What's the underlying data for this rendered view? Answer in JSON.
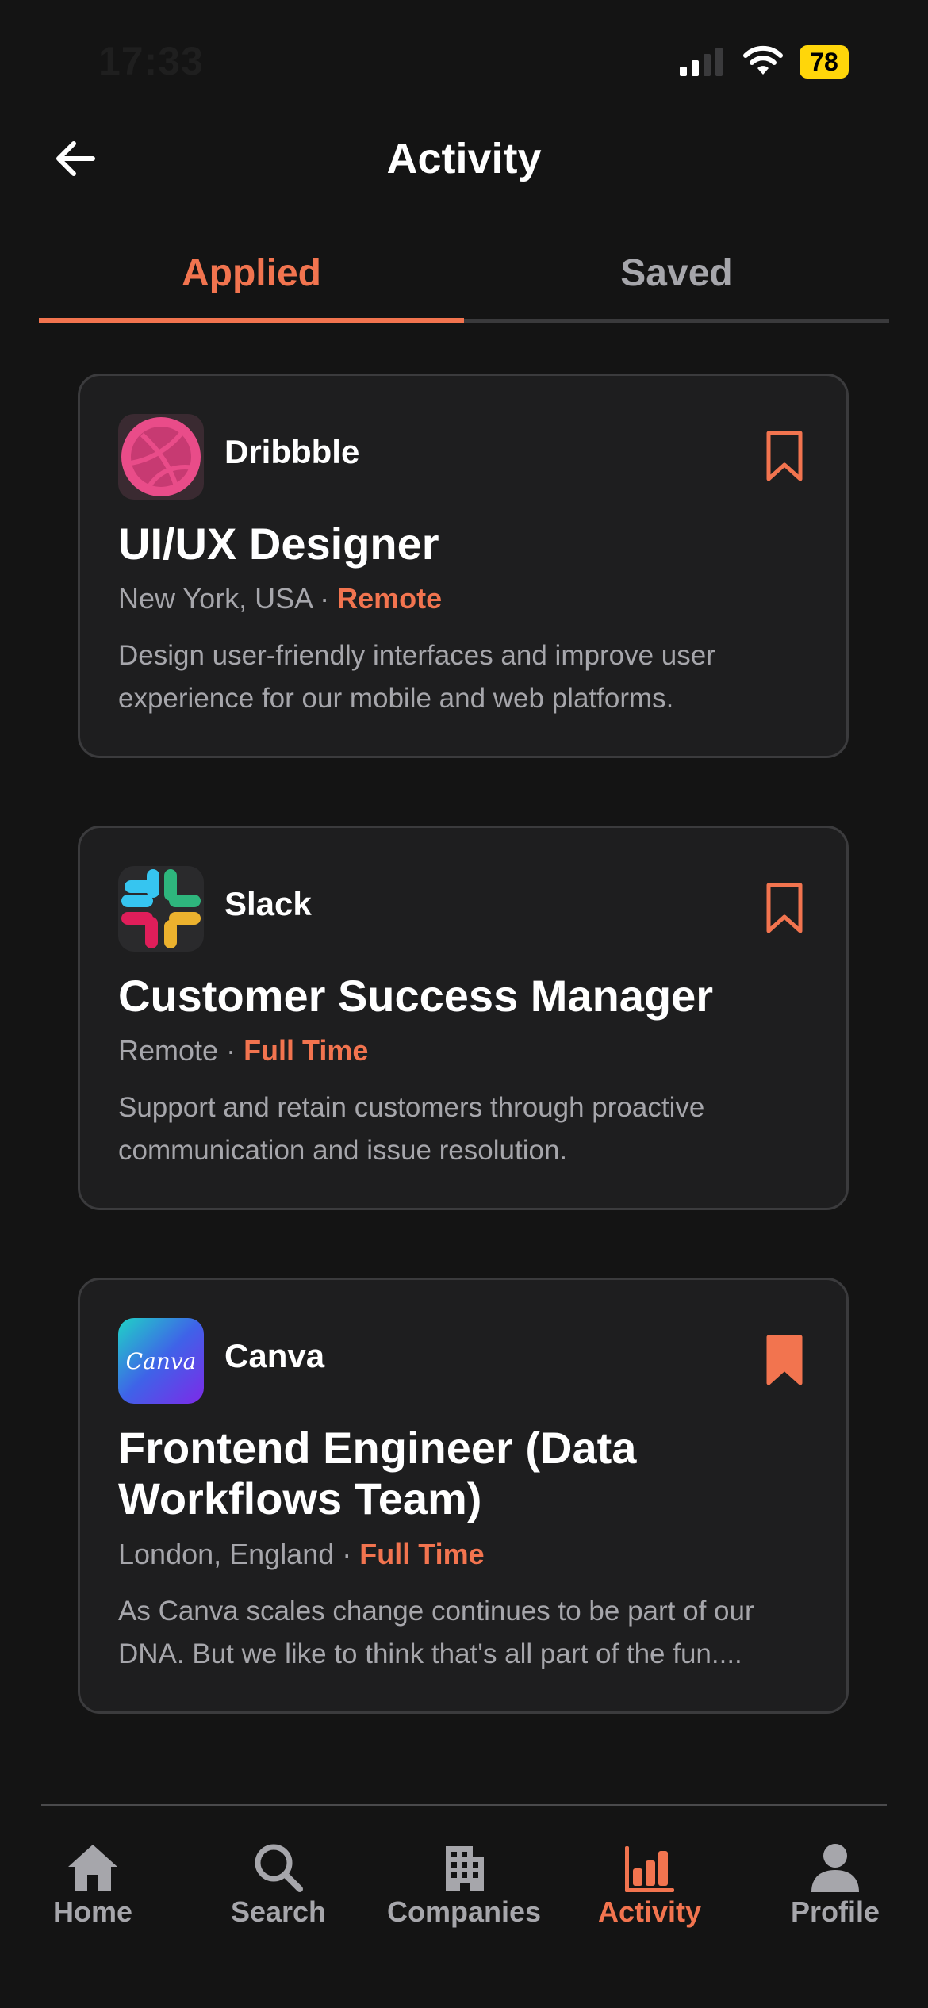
{
  "status_bar": {
    "time": "17:33",
    "battery": "78"
  },
  "header": {
    "title": "Activity",
    "back_icon": "arrow-left-icon"
  },
  "tabs": [
    {
      "label": "Applied",
      "active": true
    },
    {
      "label": "Saved",
      "active": false
    }
  ],
  "colors": {
    "accent": "#f2744f",
    "background": "#141414",
    "card": "#1e1e1f",
    "muted_text": "#a6a6ab"
  },
  "jobs": [
    {
      "company": "Dribbble",
      "logo": "dribbble-logo",
      "title": "UI/UX Designer",
      "location": "New York, USA",
      "separator": " · ",
      "tag": "Remote",
      "description": "Design user-friendly interfaces and improve user experience for our mobile and web platforms.",
      "bookmarked": false
    },
    {
      "company": "Slack",
      "logo": "slack-logo",
      "title": "Customer Success Manager",
      "location": "Remote",
      "separator": " · ",
      "tag": "Full Time",
      "description": "Support and retain customers through proactive communication and issue resolution.",
      "bookmarked": false
    },
    {
      "company": "Canva",
      "logo": "canva-logo",
      "logo_text": "Canva",
      "title": "Frontend Engineer (Data Workflows Team)",
      "location": "London, England",
      "separator": " · ",
      "tag": "Full Time",
      "description": "As Canva scales change continues to be part of our DNA. But we like to think that's all part of the fun....",
      "bookmarked": true
    }
  ],
  "bottom_nav": [
    {
      "label": "Home",
      "icon": "home-icon",
      "active": false
    },
    {
      "label": "Search",
      "icon": "search-icon",
      "active": false
    },
    {
      "label": "Companies",
      "icon": "building-icon",
      "active": false
    },
    {
      "label": "Activity",
      "icon": "bar-chart-icon",
      "active": true
    },
    {
      "label": "Profile",
      "icon": "person-icon",
      "active": false
    }
  ]
}
